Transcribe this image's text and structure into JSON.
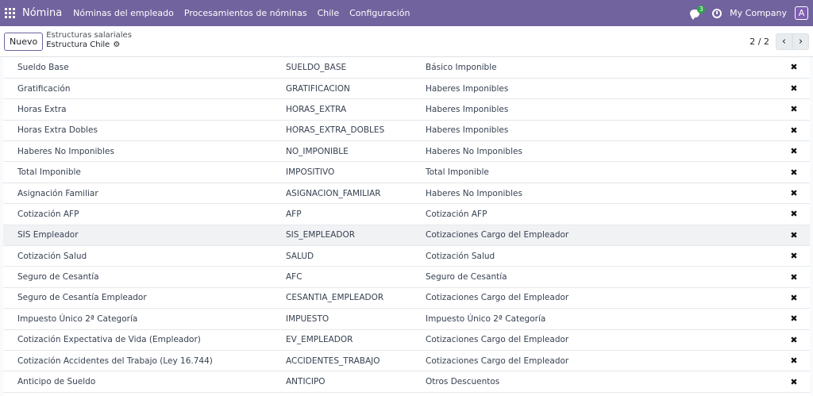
{
  "navbar": {
    "brand": "Nómina",
    "menu": [
      "Nóminas del empleado",
      "Procesamientos de nóminas",
      "Chile",
      "Configuración"
    ],
    "chat_badge": "3",
    "company": "My Company",
    "avatar_letter": "A"
  },
  "control_panel": {
    "new_button": "Nuevo",
    "breadcrumb_parent": "Estructuras salariales",
    "breadcrumb_current": "Estructura Chile",
    "pager": "2 / 2"
  },
  "rules": [
    {
      "name": "Sueldo Base",
      "code": "SUELDO_BASE",
      "category": "Básico Imponible"
    },
    {
      "name": "Gratificación",
      "code": "GRATIFICACION",
      "category": "Haberes Imponibles"
    },
    {
      "name": "Horas Extra",
      "code": "HORAS_EXTRA",
      "category": "Haberes Imponibles"
    },
    {
      "name": "Horas Extra Dobles",
      "code": "HORAS_EXTRA_DOBLES",
      "category": "Haberes Imponibles"
    },
    {
      "name": "Haberes No Imponibles",
      "code": "NO_IMPONIBLE",
      "category": "Haberes No Imponibles"
    },
    {
      "name": "Total Imponible",
      "code": "IMPOSITIVO",
      "category": "Total Imponible"
    },
    {
      "name": "Asignación Familiar",
      "code": "ASIGNACION_FAMILIAR",
      "category": "Haberes No Imponibles"
    },
    {
      "name": "Cotización AFP",
      "code": "AFP",
      "category": "Cotización AFP"
    },
    {
      "name": "SIS Empleador",
      "code": "SIS_EMPLEADOR",
      "category": "Cotizaciones Cargo del Empleador"
    },
    {
      "name": "Cotización Salud",
      "code": "SALUD",
      "category": "Cotización Salud"
    },
    {
      "name": "Seguro de Cesantía",
      "code": "AFC",
      "category": "Seguro de Cesantía"
    },
    {
      "name": "Seguro de Cesantía Empleador",
      "code": "CESANTIA_EMPLEADOR",
      "category": "Cotizaciones Cargo del Empleador"
    },
    {
      "name": "Impuesto Único 2ª Categoría",
      "code": "IMPUESTO",
      "category": "Impuesto Único 2ª Categoría"
    },
    {
      "name": "Cotización Expectativa de Vida (Empleador)",
      "code": "EV_EMPLEADOR",
      "category": "Cotizaciones Cargo del Empleador"
    },
    {
      "name": "Cotización Accidentes del Trabajo (Ley 16.744)",
      "code": "ACCIDENTES_TRABAJO",
      "category": "Cotizaciones Cargo del Empleador"
    },
    {
      "name": "Anticipo de Sueldo",
      "code": "ANTICIPO",
      "category": "Otros Descuentos"
    }
  ],
  "highlighted_row": 8,
  "colors": {
    "navbar": "#71639e",
    "badge": "#28a745"
  }
}
